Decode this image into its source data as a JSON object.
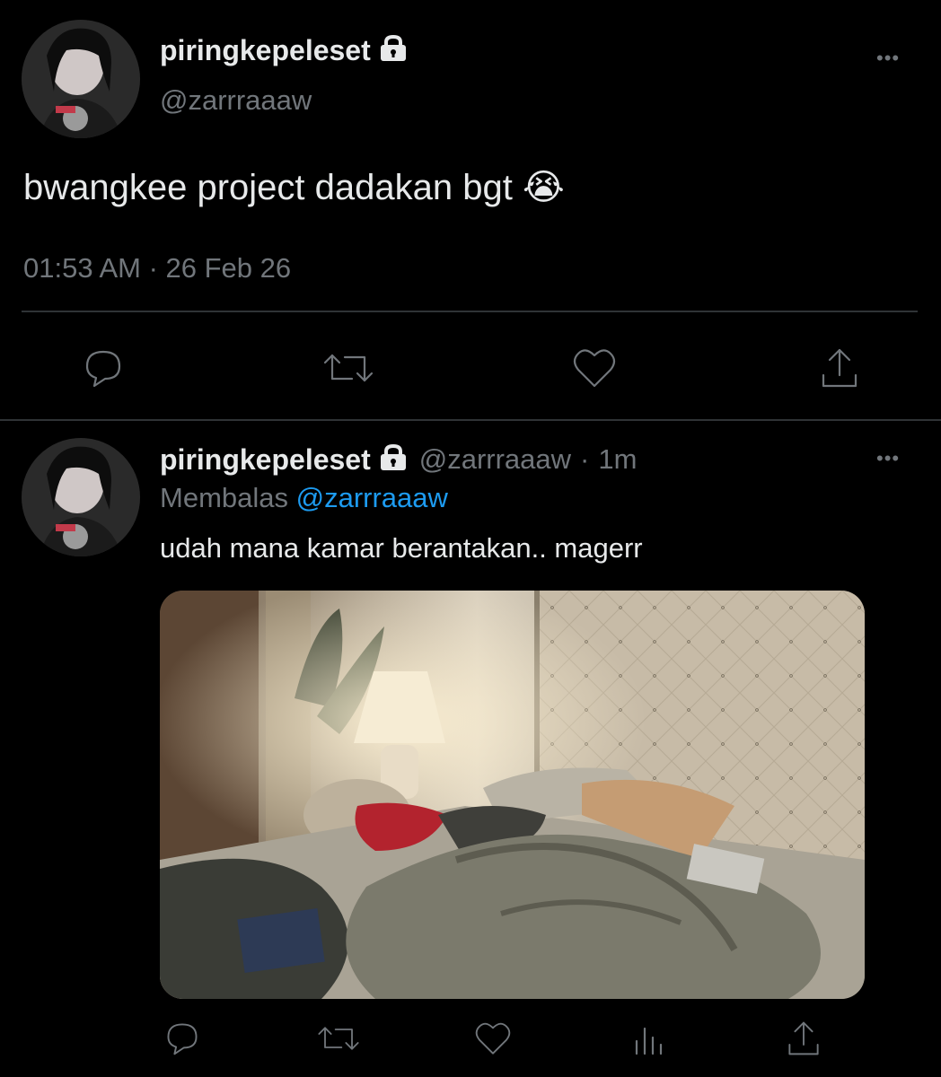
{
  "main_tweet": {
    "display_name": "piringkepeleset",
    "handle": "@zarrraaaw",
    "text": "bwangkee project dadakan bgt 😭",
    "timestamp": "01:53 AM · 26 Feb 26",
    "more_label": "•••",
    "actions": [
      "reply-icon",
      "retweet-icon",
      "like-icon",
      "share-icon"
    ]
  },
  "reply_tweet": {
    "display_name": "piringkepeleset",
    "handle": "@zarrraaaw",
    "separator": "·",
    "age": "1m",
    "replying_prefix": "Membalas",
    "replying_to": "@zarrraaaw",
    "text": "udah mana kamar berantakan.. magerr",
    "more_label": "•••",
    "actions": [
      "reply-icon",
      "retweet-icon",
      "like-icon",
      "analytics-icon",
      "share-icon"
    ]
  },
  "colors": {
    "background": "#000000",
    "text": "#e7e9ea",
    "secondary": "#71767b",
    "link": "#1d9bf0",
    "divider": "#2f3336"
  }
}
